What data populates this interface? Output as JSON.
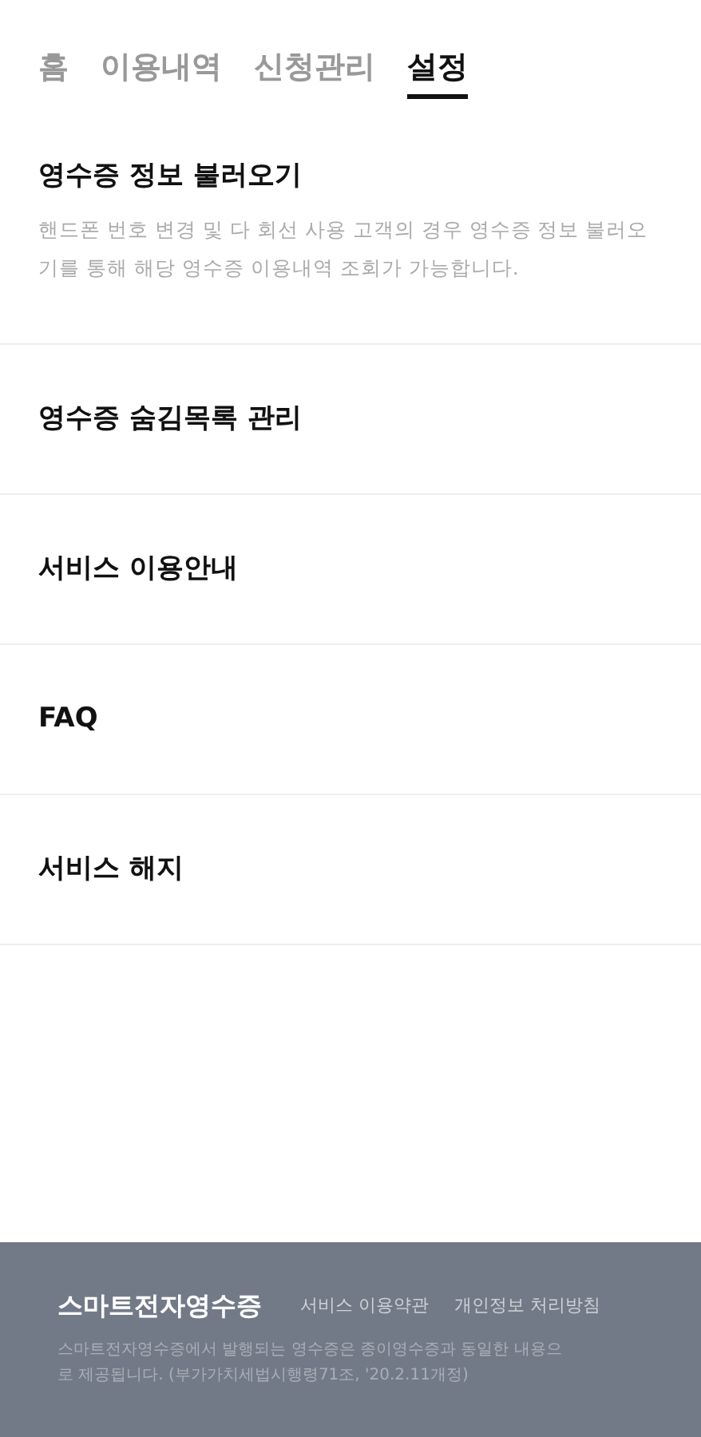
{
  "tabs": [
    {
      "label": "홈",
      "selected": false
    },
    {
      "label": "이용내역",
      "selected": false
    },
    {
      "label": "신청관리",
      "selected": false
    },
    {
      "label": "설정",
      "selected": true
    }
  ],
  "menu": [
    {
      "title": "영수증 정보 불러오기",
      "description": "핸드폰 번호 변경 및 다 회선 사용 고객의 경우 영수증 정보 불러오기를 통해 해당 영수증 이용내역 조회가 가능합니다."
    },
    {
      "title": "영수증 숨김목록 관리"
    },
    {
      "title": "서비스 이용안내"
    },
    {
      "title": "FAQ"
    },
    {
      "title": "서비스 해지"
    }
  ],
  "footer": {
    "brand": "스마트전자영수증",
    "links": [
      "서비스 이용약관",
      "개인정보 처리방침"
    ],
    "notice": "스마트전자영수증에서 발행되는 영수증은 종이영수증과 동일한 내용으로 제공됩니다. (부가가치세법시행령71조, '20.2.11개정)"
  }
}
